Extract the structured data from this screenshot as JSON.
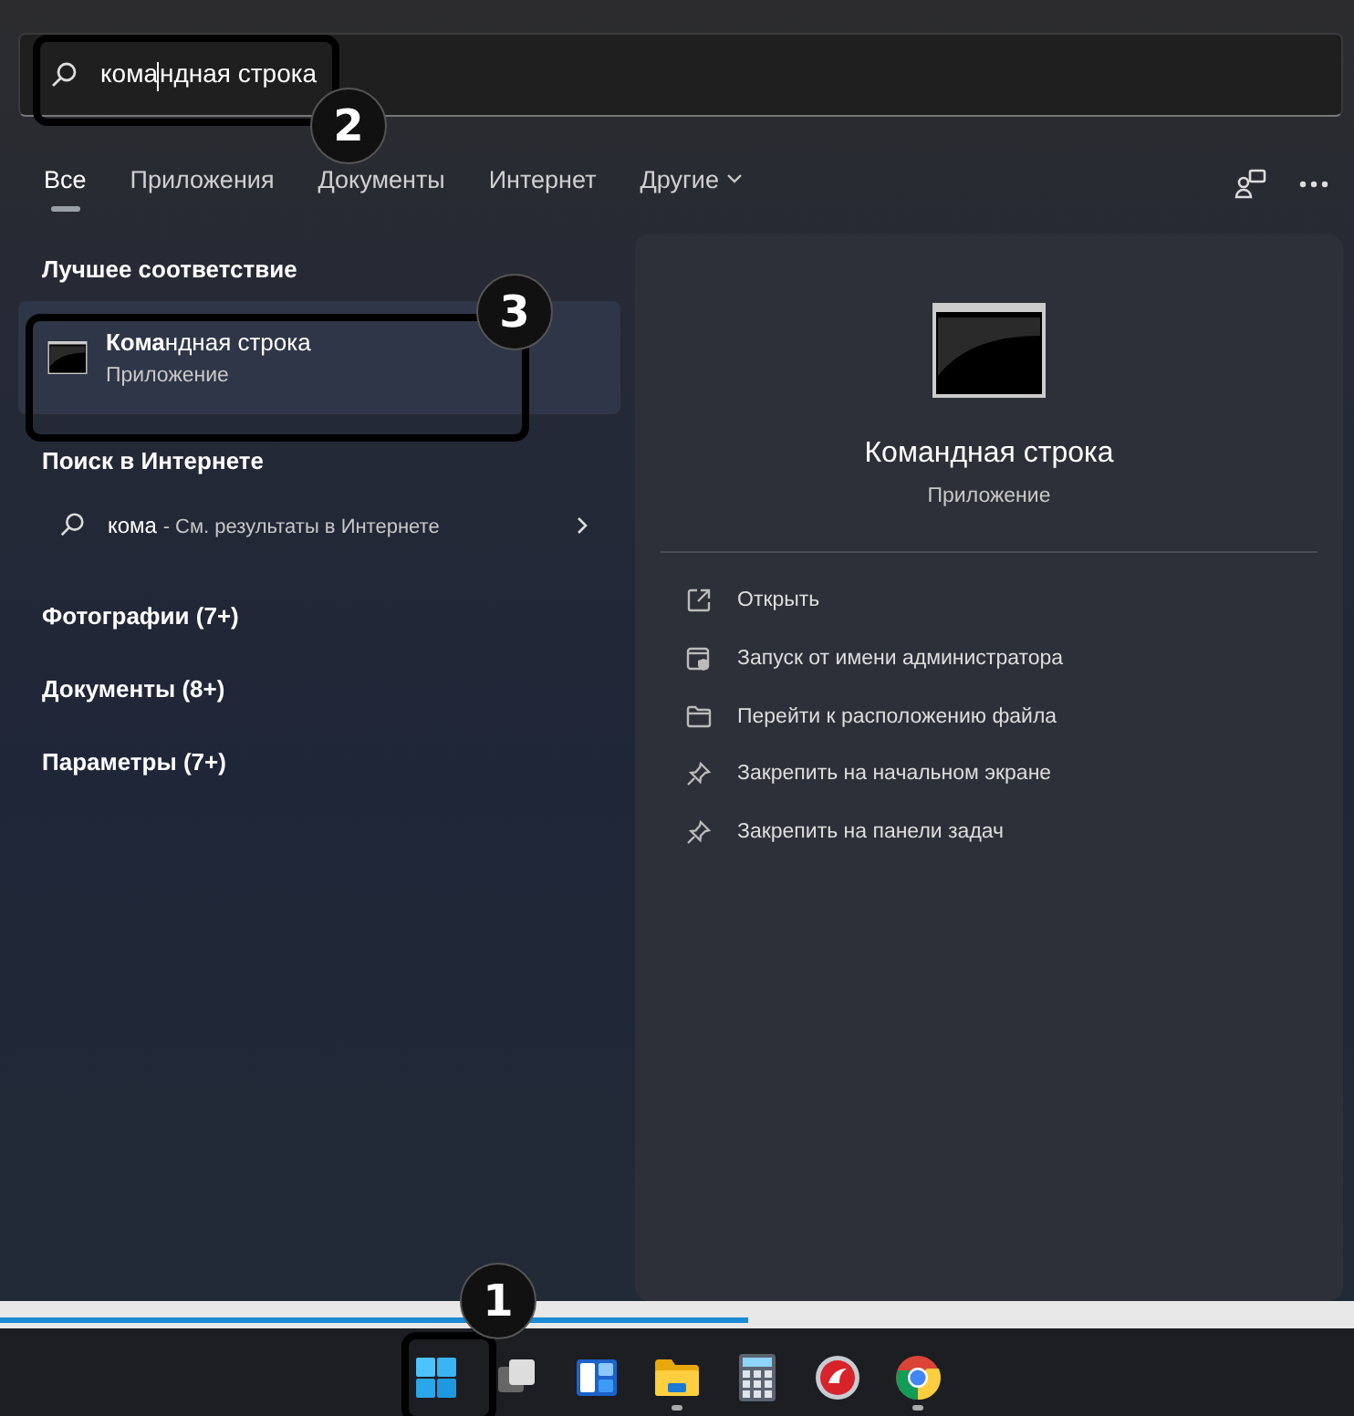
{
  "search": {
    "query": "кома",
    "completion": "ндная строка"
  },
  "tabs": [
    {
      "label": "Все",
      "selected": true
    },
    {
      "label": "Приложения",
      "selected": false
    },
    {
      "label": "Документы",
      "selected": false
    },
    {
      "label": "Интернет",
      "selected": false
    },
    {
      "label": "Другие",
      "selected": false,
      "dropdown": true
    }
  ],
  "best_match": {
    "heading": "Лучшее соответствие",
    "title": "**Кома**ндная строка",
    "subtitle": "Приложение",
    "selected": true
  },
  "web_search": {
    "heading": "Поиск в Интернете",
    "query": "кома",
    "hint": "- См. результаты в Интернете"
  },
  "categories": [
    "Фотографии (7+)",
    "Документы (8+)",
    "Параметры (7+)"
  ],
  "preview": {
    "title": "Командная строка",
    "subtitle": "Приложение",
    "actions": [
      {
        "kind": "open",
        "label": "Открыть"
      },
      {
        "kind": "admin",
        "label": "Запуск от имени администратора"
      },
      {
        "kind": "folder",
        "label": "Перейти к расположению файла"
      },
      {
        "kind": "pin",
        "label": "Закрепить на начальном экране"
      },
      {
        "kind": "pin",
        "label": "Закрепить на панели задач"
      }
    ]
  },
  "taskbar": [
    {
      "kind": "start",
      "running": false
    },
    {
      "kind": "taskview",
      "running": false
    },
    {
      "kind": "widgets",
      "running": false
    },
    {
      "kind": "explorer",
      "running": true
    },
    {
      "kind": "calculator",
      "running": false
    },
    {
      "kind": "redapp",
      "running": false
    },
    {
      "kind": "chrome",
      "running": true
    }
  ],
  "callouts": [
    "1",
    "2",
    "3"
  ]
}
